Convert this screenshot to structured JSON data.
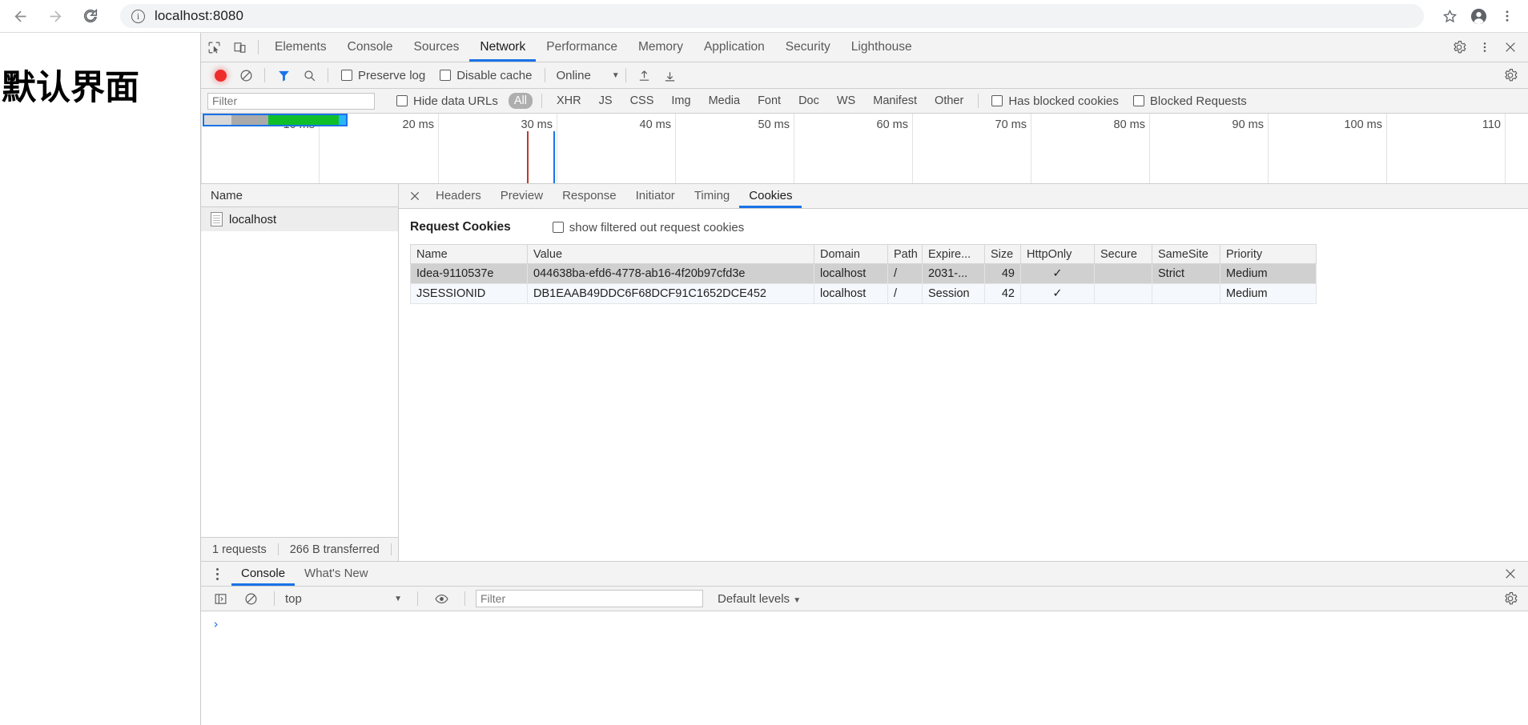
{
  "browser": {
    "back_icon": "arrow-left-icon",
    "forward_icon": "arrow-right-icon",
    "reload_icon": "reload-icon",
    "info_glyph": "i",
    "url": "localhost:8080",
    "star_icon": "bookmark-star-icon",
    "profile_icon": "profile-avatar-icon",
    "menu_icon": "kebab-menu-icon"
  },
  "page": {
    "heading": "默认界面"
  },
  "devtools": {
    "inspect_icon": "inspect-element-icon",
    "device_icon": "device-toolbar-icon",
    "tabs": [
      {
        "label": "Elements",
        "active": false
      },
      {
        "label": "Console",
        "active": false
      },
      {
        "label": "Sources",
        "active": false
      },
      {
        "label": "Network",
        "active": true
      },
      {
        "label": "Performance",
        "active": false
      },
      {
        "label": "Memory",
        "active": false
      },
      {
        "label": "Application",
        "active": false
      },
      {
        "label": "Security",
        "active": false
      },
      {
        "label": "Lighthouse",
        "active": false
      }
    ],
    "settings_icon": "gear-icon",
    "more_icon": "kebab-menu-icon",
    "close_icon": "close-icon"
  },
  "network_toolbar": {
    "record_icon": "record-stop-icon",
    "clear_icon": "clear-circle-slash-icon",
    "filter_icon": "funnel-filter-icon",
    "search_icon": "search-icon",
    "preserve_log_label": "Preserve log",
    "preserve_log_checked": false,
    "disable_cache_label": "Disable cache",
    "disable_cache_checked": false,
    "throttling_value": "Online",
    "import_icon": "import-har-upload-icon",
    "export_icon": "export-har-download-icon",
    "network_settings_icon": "gear-icon"
  },
  "filter_bar": {
    "filter_placeholder": "Filter",
    "filter_value": "",
    "hide_data_urls_label": "Hide data URLs",
    "hide_data_urls_checked": false,
    "types": [
      {
        "label": "All",
        "active": true
      },
      {
        "label": "XHR",
        "active": false
      },
      {
        "label": "JS",
        "active": false
      },
      {
        "label": "CSS",
        "active": false
      },
      {
        "label": "Img",
        "active": false
      },
      {
        "label": "Media",
        "active": false
      },
      {
        "label": "Font",
        "active": false
      },
      {
        "label": "Doc",
        "active": false
      },
      {
        "label": "WS",
        "active": false
      },
      {
        "label": "Manifest",
        "active": false
      },
      {
        "label": "Other",
        "active": false
      }
    ],
    "has_blocked_cookies_label": "Has blocked cookies",
    "has_blocked_cookies_checked": false,
    "blocked_requests_label": "Blocked Requests",
    "blocked_requests_checked": false
  },
  "overview": {
    "ticks": [
      "10 ms",
      "20 ms",
      "30 ms",
      "40 ms",
      "50 ms",
      "60 ms",
      "70 ms",
      "80 ms",
      "90 ms",
      "100 ms",
      "110"
    ],
    "bar_segments": [
      {
        "name": "queueing",
        "color": "#d8d8d8",
        "width_pct": 19
      },
      {
        "name": "stalled",
        "color": "#aaaaaa",
        "width_pct": 26
      },
      {
        "name": "content-download",
        "color": "#0fbf2a",
        "width_pct": 50
      },
      {
        "name": "waiting",
        "color": "#29b6f6",
        "width_pct": 5
      }
    ],
    "bar_border_color": "#1a73e8",
    "events": [
      {
        "name": "dom-content-loaded",
        "color": "#c0392b",
        "x_ms": 27.5
      },
      {
        "name": "load",
        "color": "#1a73e8",
        "x_ms": 29.7
      }
    ]
  },
  "requests": {
    "column_header": "Name",
    "rows": [
      {
        "name": "localhost",
        "icon": "document-icon",
        "selected": true
      }
    ],
    "status": {
      "count": "1 requests",
      "transferred": "266 B transferred"
    }
  },
  "details": {
    "close_icon": "close-icon",
    "tabs": [
      {
        "label": "Headers",
        "active": false
      },
      {
        "label": "Preview",
        "active": false
      },
      {
        "label": "Response",
        "active": false
      },
      {
        "label": "Initiator",
        "active": false
      },
      {
        "label": "Timing",
        "active": false
      },
      {
        "label": "Cookies",
        "active": true
      }
    ],
    "cookies_section_title": "Request Cookies",
    "show_filtered_label": "show filtered out request cookies",
    "show_filtered_checked": false,
    "columns": [
      "Name",
      "Value",
      "Domain",
      "Path",
      "Expire...",
      "Size",
      "HttpOnly",
      "Secure",
      "SameSite",
      "Priority"
    ],
    "rows": [
      {
        "selected": true,
        "cells": [
          "Idea-9110537e",
          "044638ba-efd6-4778-ab16-4f20b97cfd3e",
          "localhost",
          "/",
          "2031-...",
          "49",
          "✓",
          "",
          "Strict",
          "Medium"
        ]
      },
      {
        "selected": false,
        "cells": [
          "JSESSIONID",
          "DB1EAAB49DDC6F68DCF91C1652DCE452",
          "localhost",
          "/",
          "Session",
          "42",
          "✓",
          "",
          "",
          "Medium"
        ]
      }
    ]
  },
  "drawer": {
    "more_tools_icon": "kebab-menu-icon",
    "tabs": [
      {
        "label": "Console",
        "active": true
      },
      {
        "label": "What's New",
        "active": false
      }
    ],
    "close_icon": "close-icon",
    "sidebar_icon": "console-sidebar-icon",
    "clear_icon": "clear-circle-slash-icon",
    "context": "top",
    "live_expression_icon": "eye-icon",
    "filter_placeholder": "Filter",
    "filter_value": "",
    "levels_label": "Default levels",
    "settings_icon": "gear-icon",
    "prompt_glyph": "›"
  }
}
